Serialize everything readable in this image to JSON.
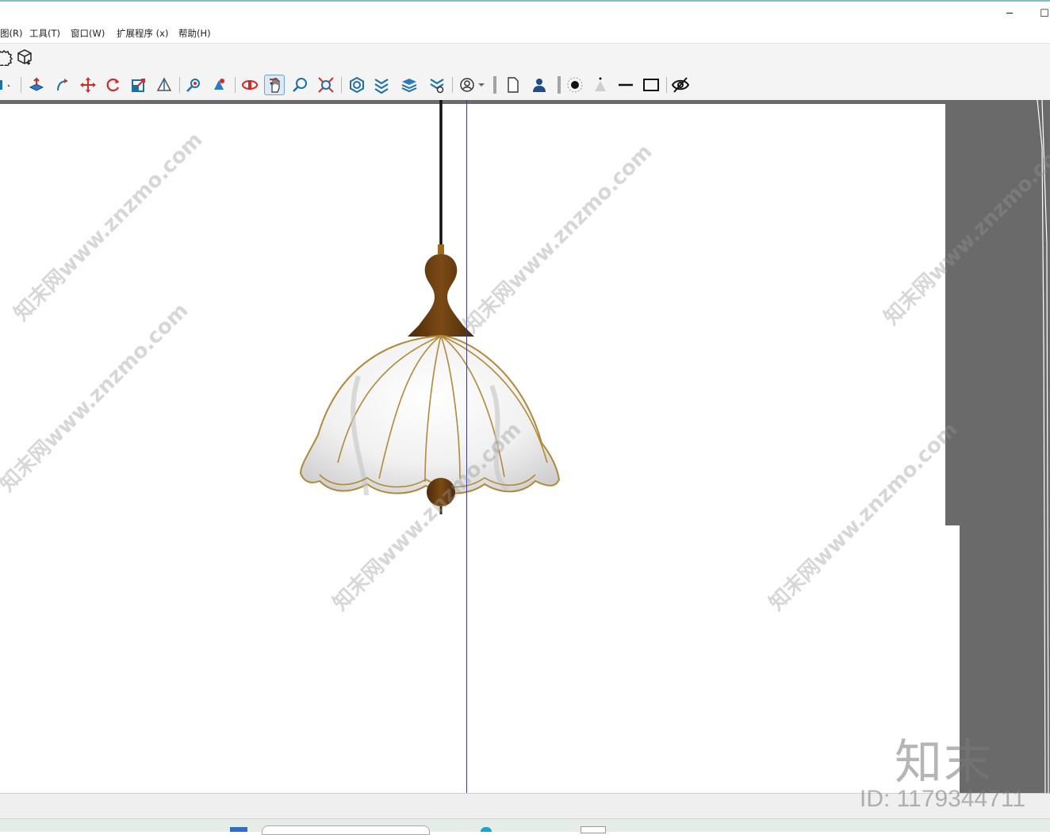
{
  "window": {
    "minimize_glyph": "─",
    "maximize_glyph": "☐"
  },
  "menu": [
    {
      "label": "图(R)"
    },
    {
      "label": "工具(T)"
    },
    {
      "label": "窗口(W)"
    },
    {
      "label": "扩展程序 (x)"
    },
    {
      "label": "帮助(H)"
    }
  ],
  "toolbar1": {
    "items": [
      "settings-icon",
      "component-box-icon"
    ]
  },
  "toolbar2": {
    "items": [
      "push-pull-icon",
      "follow-me-icon",
      "move-icon",
      "rotate-icon",
      "scale-icon",
      "tape-measure-icon",
      "orbit-icon",
      "look-around-icon",
      "walk-icon",
      "pan-hand-icon",
      "zoom-icon",
      "zoom-extents-icon",
      "warehouse-icon",
      "extension-icon",
      "layers-icon",
      "extension-warehouse-icon",
      "profile-icon",
      "document-icon",
      "user-icon",
      "point-icon",
      "cone-icon",
      "line-icon",
      "rectangle-icon",
      "hide-icon"
    ],
    "active": "pan-hand-icon"
  },
  "watermarks": [
    {
      "text": "知末网www.znzmo.com"
    },
    {
      "text": "知末网www.znzmo.com"
    },
    {
      "text": "知末网www.znzmo.com"
    },
    {
      "text": "知末网www.znzmo.com"
    },
    {
      "text": "知末网www.znzmo.com"
    },
    {
      "text": "知末网www.znzmo.com"
    }
  ],
  "brand": {
    "logo_text": "知末",
    "id_text": "ID: 1179344711"
  },
  "colors": {
    "accent": "#6ea4d8",
    "toolbar_red": "#d32b2b",
    "toolbar_blue": "#1d6fa8",
    "lamp_wood": "#6b3f0f",
    "lamp_trim": "#b08a3a"
  }
}
